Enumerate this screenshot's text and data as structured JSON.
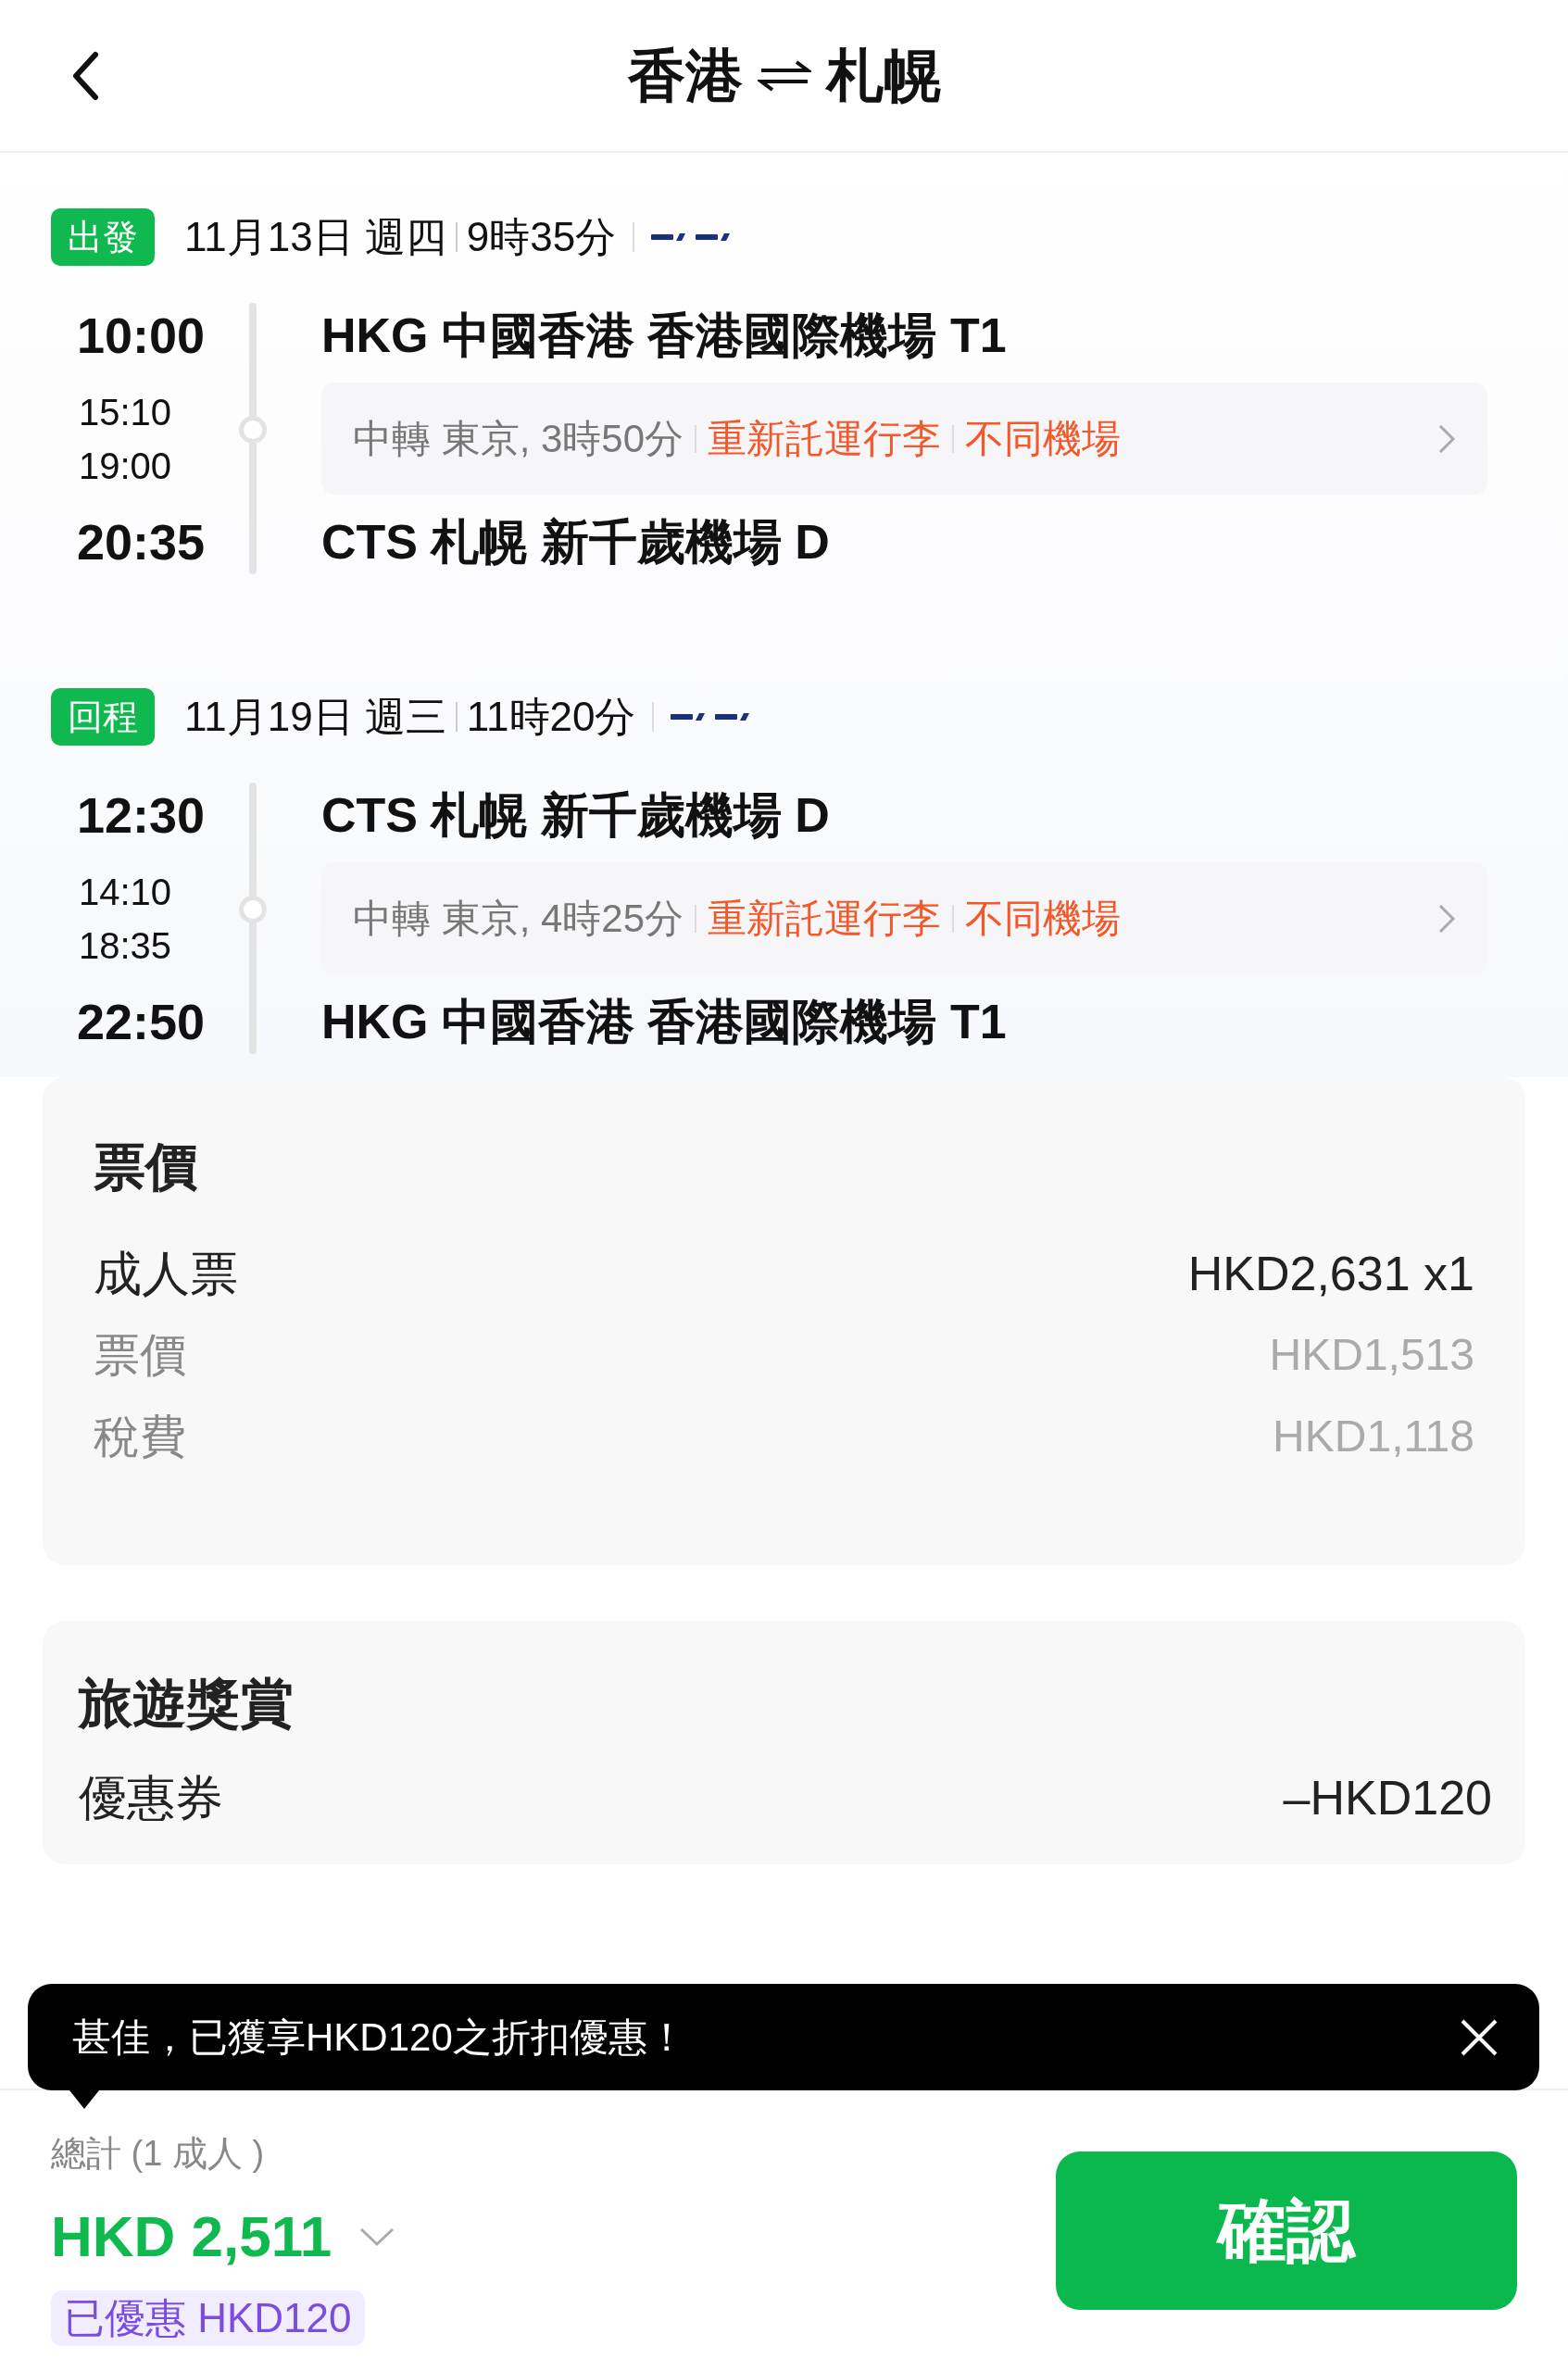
{
  "header": {
    "from": "香港",
    "to": "札幌"
  },
  "segments": [
    {
      "badge": "出發",
      "date": "11月13日 週四",
      "duration": "9時35分",
      "departure_time": "10:00",
      "departure_airport": "HKG 中國香港 香港國際機場 T1",
      "transfer": {
        "times": [
          "15:10",
          "19:00"
        ],
        "text": "中轉 東京, 3時50分",
        "tags": [
          "重新託運行李",
          "不同機場"
        ]
      },
      "arrival_time": "20:35",
      "arrival_airport": "CTS 札幌 新千歲機場 D"
    },
    {
      "badge": "回程",
      "date": "11月19日 週三",
      "duration": "11時20分",
      "departure_time": "12:30",
      "departure_airport": "CTS 札幌 新千歲機場 D",
      "transfer": {
        "times": [
          "14:10",
          "18:35"
        ],
        "text": "中轉 東京, 4時25分",
        "tags": [
          "重新託運行李",
          "不同機場"
        ]
      },
      "arrival_time": "22:50",
      "arrival_airport": "HKG 中國香港 香港國際機場 T1"
    }
  ],
  "fare": {
    "title": "票價",
    "rows": [
      {
        "kind": "main",
        "label": "成人票",
        "value": "HKD2,631 x1"
      },
      {
        "kind": "sub",
        "label": "票價",
        "value": "HKD1,513"
      },
      {
        "kind": "sub",
        "label": "稅費",
        "value": "HKD1,118"
      }
    ]
  },
  "rewards": {
    "title": "旅遊獎賞",
    "rows": [
      {
        "label": "優惠券",
        "value": "–HKD120"
      }
    ]
  },
  "toast": {
    "message": "甚佳，已獲享HKD120之折扣優惠！"
  },
  "footer": {
    "total_label": "總計 (1 成人 )",
    "total": "HKD 2,511",
    "discount": "已優惠 HKD120",
    "confirm": "確認"
  }
}
